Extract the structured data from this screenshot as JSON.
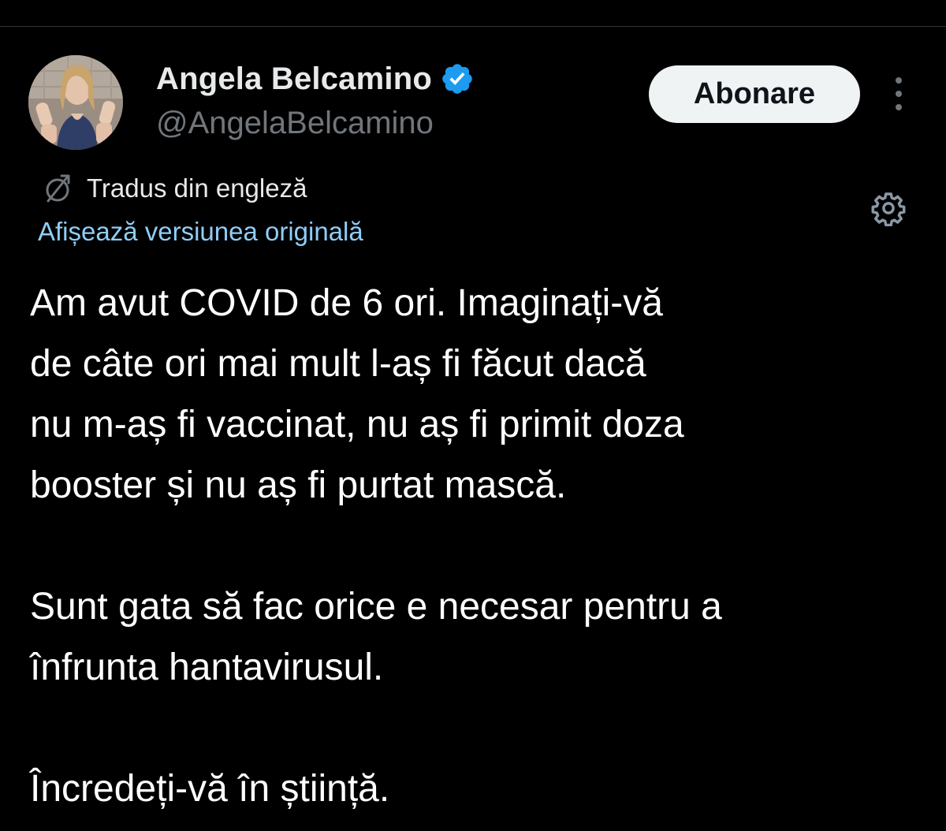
{
  "author": {
    "display_name": "Angela Belcamino",
    "handle": "@AngelaBelcamino",
    "verified": true,
    "verified_color": "#1d9bf0"
  },
  "actions": {
    "follow_label": "Abonare",
    "more_icon": "more-vertical-icon"
  },
  "translation": {
    "icon": "translate-icon",
    "label": "Tradus din engleză",
    "show_original_label": "Afișează versiunea originală",
    "settings_icon": "gear-icon",
    "link_color": "#8ecdf8"
  },
  "tweet": {
    "paragraphs": [
      "Am avut COVID de 6 ori. Imaginați-vă\nde câte ori mai mult l-aș fi făcut dacă\nnu m-aș fi vaccinat, nu aș fi primit doza\nbooster și nu aș fi purtat mască.",
      "Sunt gata să fac orice e necesar pentru a\nînfrunta hantavirusul.",
      "Încredeți-vă în știință."
    ]
  },
  "colors": {
    "background": "#000000",
    "text_primary": "#e7e9ea",
    "text_secondary": "#71767b",
    "button_bg": "#eff3f4"
  }
}
